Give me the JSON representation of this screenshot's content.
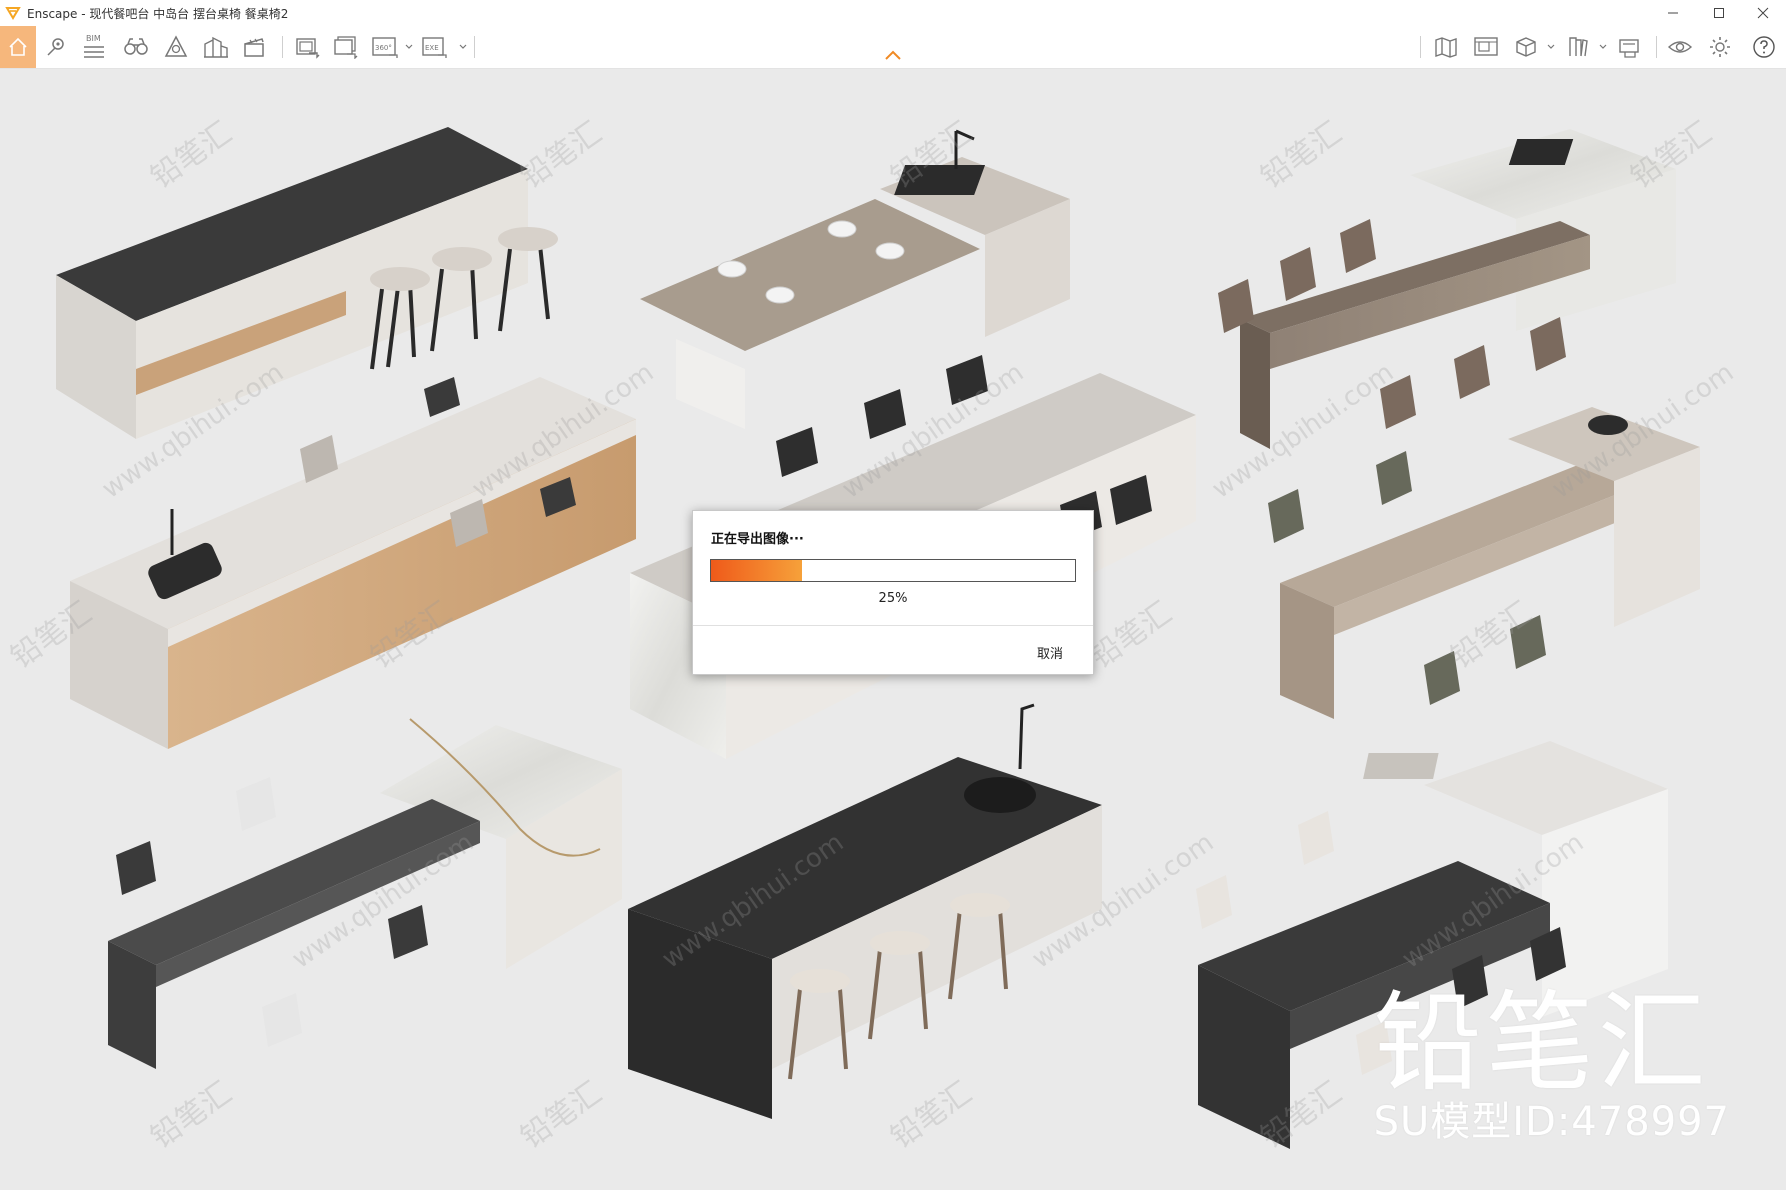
{
  "window": {
    "title": "Enscape - 现代餐吧台 中岛台 摆台桌椅 餐桌椅2",
    "brand_color": "#f5a623"
  },
  "toolbar": {
    "bim_label": "BIM",
    "badge_360": "360°",
    "badge_exe": "EXE",
    "left_icons": [
      "home-icon",
      "location-pin-icon",
      "bim-list-icon",
      "binoculars-icon",
      "asset-library-icon",
      "buildings-icon",
      "video-editor-icon",
      "screenshot-icon",
      "batch-render-icon",
      "panorama-360-icon",
      "export-exe-icon"
    ],
    "right_icons": [
      "map-icon",
      "render-window-icon",
      "cube-view-icon",
      "bookmarks-icon",
      "capture-icon",
      "visual-settings-icon",
      "settings-icon",
      "help-icon"
    ],
    "accent_color": "#f6b77c"
  },
  "dialog": {
    "title": "正在导出图像···",
    "progress": 0.25,
    "percent_label": "25%",
    "cancel_label": "取消",
    "progress_color_start": "#ef5a1a",
    "progress_color_end": "#f6a13a"
  },
  "watermark": {
    "brand_name": "铅笔汇",
    "model_id": "SU模型ID:478997",
    "tile_text_cn": "铅笔汇",
    "tile_text_url": "www.qbihui.com"
  }
}
